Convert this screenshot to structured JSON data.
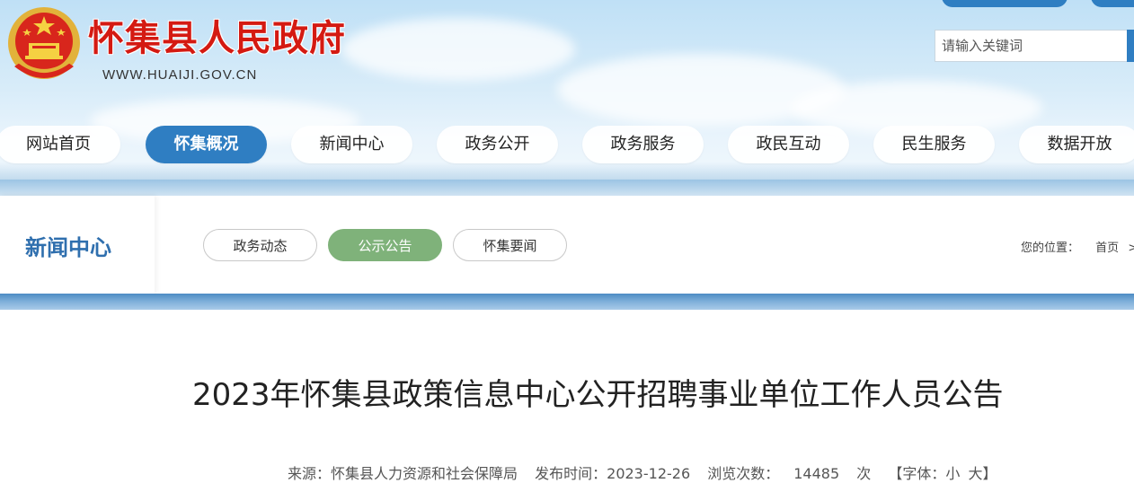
{
  "header": {
    "site_title": "怀集县人民政府",
    "site_url": "WWW.HUAIJI.GOV.CN",
    "search_placeholder": "请输入关键词",
    "emblem_icon": "national-emblem-icon"
  },
  "nav": {
    "items": [
      {
        "label": "网站首页"
      },
      {
        "label": "怀集概况",
        "active": true
      },
      {
        "label": "新闻中心"
      },
      {
        "label": "政务公开"
      },
      {
        "label": "政务服务"
      },
      {
        "label": "政民互动"
      },
      {
        "label": "民生服务"
      },
      {
        "label": "数据开放"
      }
    ]
  },
  "section": {
    "title": "新闻中心",
    "tabs": [
      {
        "label": "政务动态"
      },
      {
        "label": "公示公告",
        "active": true
      },
      {
        "label": "怀集要闻"
      }
    ],
    "breadcrumb": {
      "prefix": "您的位置：",
      "home": "首页",
      "separator": ">"
    }
  },
  "article": {
    "title": "2023年怀集县政策信息中心公开招聘事业单位工作人员公告",
    "meta": {
      "source_label": "来源：",
      "source": "怀集县人力资源和社会保障局",
      "date_label": "发布时间：",
      "date": "2023-12-26",
      "views_label": "浏览次数：",
      "views": "14485",
      "views_unit": "次",
      "font_label": "【字体：",
      "font_small": "小",
      "font_large": "大】"
    }
  },
  "colors": {
    "accent_blue": "#2f7ec2",
    "active_green": "#7fb27a",
    "title_red": "#d41a12"
  }
}
